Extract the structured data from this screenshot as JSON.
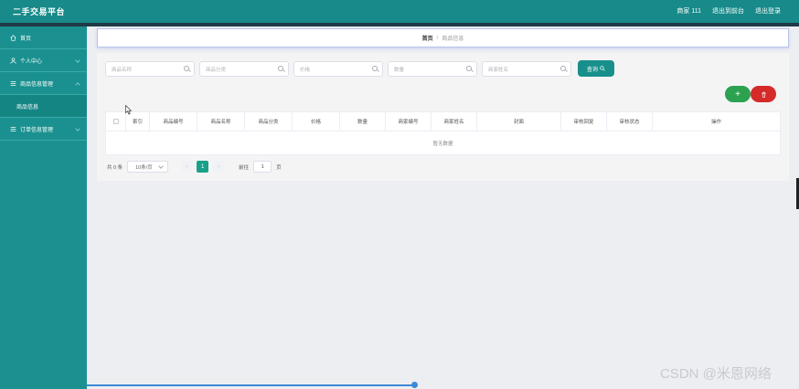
{
  "header": {
    "title": "二手交易平台",
    "user": "商家 111",
    "to_front": "退出到前台",
    "logout": "退出登录"
  },
  "sidebar": {
    "items": [
      {
        "label": "首页",
        "icon": "home-icon"
      },
      {
        "label": "个人中心",
        "icon": "user-icon"
      },
      {
        "label": "商品信息管理",
        "icon": "list-icon"
      },
      {
        "label": "订单信息管理",
        "icon": "list-icon"
      }
    ],
    "submenu_item": "商品信息"
  },
  "breadcrumb": {
    "home": "首页",
    "sep": "/",
    "current": "商品信息"
  },
  "search": {
    "fields": [
      "商品名称",
      "商品分类",
      "价格",
      "数量",
      "商家姓名"
    ],
    "button": "查询"
  },
  "actions": {
    "add": "+",
    "delete": "🗑"
  },
  "table": {
    "columns": [
      "索引",
      "商品编号",
      "商品名称",
      "商品分类",
      "价格",
      "数量",
      "商家编号",
      "商家姓名",
      "封面",
      "审核回复",
      "审核状态",
      "操作"
    ],
    "empty_text": "暂无数据"
  },
  "pager": {
    "total": "共 0 条",
    "page_size": "10条/页",
    "prev": "‹",
    "current_page": "1",
    "next": "›",
    "goto_label": "前往",
    "goto_value": "1",
    "page_suffix": "页"
  },
  "watermark": "CSDN @米恩网络",
  "colors": {
    "primary": "#178a89",
    "sidebar": "#1a9190",
    "success": "#2ca150",
    "danger": "#d42a2a"
  }
}
